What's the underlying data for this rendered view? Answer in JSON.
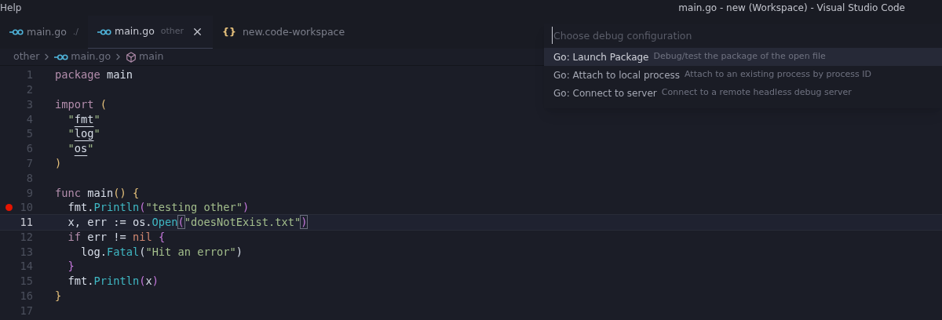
{
  "menu": {
    "label": "Help"
  },
  "window": {
    "title": "main.go - new (Workspace) - Visual Studio Code"
  },
  "tabs": [
    {
      "kind": "go",
      "label": "main.go",
      "description": "./",
      "selected": false
    },
    {
      "kind": "go",
      "label": "main.go",
      "description": "other",
      "selected": true
    },
    {
      "kind": "json",
      "icon": "{}",
      "label": "new.code-workspace",
      "selected": false
    }
  ],
  "breadcrumbs": [
    {
      "kind": "folder",
      "label": "other"
    },
    {
      "kind": "go",
      "label": "main.go"
    },
    {
      "kind": "symbol",
      "label": "main"
    }
  ],
  "editor": {
    "lines": [
      {
        "number": "1",
        "breakpoint": false,
        "current": false,
        "tokens": [
          {
            "kind": "keyword",
            "text": "package"
          },
          {
            "kind": "plain",
            "text": " main"
          }
        ]
      },
      {
        "number": "2",
        "breakpoint": false,
        "current": false
      },
      {
        "number": "3",
        "breakpoint": false,
        "current": false,
        "tokens": [
          {
            "kind": "keyword",
            "text": "import "
          },
          {
            "kind": "bracket1",
            "text": "("
          }
        ]
      },
      {
        "number": "4",
        "breakpoint": false,
        "current": false,
        "tokens": [
          {
            "kind": "string",
            "text": "  \""
          },
          {
            "kind": "import",
            "text": "fmt"
          },
          {
            "kind": "string",
            "text": "\""
          }
        ]
      },
      {
        "number": "5",
        "breakpoint": false,
        "current": false,
        "tokens": [
          {
            "kind": "string",
            "text": "  \""
          },
          {
            "kind": "import",
            "text": "log"
          },
          {
            "kind": "string",
            "text": "\""
          }
        ]
      },
      {
        "number": "6",
        "breakpoint": false,
        "current": false,
        "tokens": [
          {
            "kind": "string",
            "text": "  \""
          },
          {
            "kind": "import",
            "text": "os"
          },
          {
            "kind": "string",
            "text": "\""
          }
        ]
      },
      {
        "number": "7",
        "breakpoint": false,
        "current": false,
        "tokens": [
          {
            "kind": "bracket1",
            "text": ")"
          }
        ]
      },
      {
        "number": "8",
        "breakpoint": false,
        "current": false
      },
      {
        "number": "9",
        "breakpoint": false,
        "current": false,
        "tokens": [
          {
            "kind": "keyword",
            "text": "func"
          },
          {
            "kind": "plain",
            "text": " main"
          },
          {
            "kind": "bracket1",
            "text": "() {"
          }
        ]
      },
      {
        "number": "10",
        "breakpoint": true,
        "current": false,
        "tokens": [
          {
            "kind": "plain",
            "text": "  fmt."
          },
          {
            "kind": "function",
            "text": "Println"
          },
          {
            "kind": "bracket2",
            "text": "("
          },
          {
            "kind": "string",
            "text": "\"testing other\""
          },
          {
            "kind": "bracket2",
            "text": ")"
          }
        ]
      },
      {
        "number": "11",
        "breakpoint": false,
        "current": true,
        "tokens": [
          {
            "kind": "plain",
            "text": "  x, err := os."
          },
          {
            "kind": "function",
            "text": "Open"
          },
          {
            "kind": "bracket-match",
            "text": "("
          },
          {
            "kind": "string",
            "text": "\"doesNotExist.txt\""
          },
          {
            "kind": "bracket-match",
            "text": ")"
          }
        ]
      },
      {
        "number": "12",
        "breakpoint": false,
        "current": false,
        "tokens": [
          {
            "kind": "keyword",
            "text": "  if"
          },
          {
            "kind": "plain",
            "text": " err != "
          },
          {
            "kind": "constant",
            "text": "nil "
          },
          {
            "kind": "bracket2",
            "text": "{"
          }
        ]
      },
      {
        "number": "13",
        "breakpoint": false,
        "current": false,
        "tokens": [
          {
            "kind": "plain",
            "text": "    log."
          },
          {
            "kind": "function",
            "text": "Fatal"
          },
          {
            "kind": "plain",
            "text": "("
          },
          {
            "kind": "string",
            "text": "\"Hit an error\""
          },
          {
            "kind": "plain",
            "text": ")"
          }
        ]
      },
      {
        "number": "14",
        "breakpoint": false,
        "current": false,
        "tokens": [
          {
            "kind": "bracket2",
            "text": "  }"
          }
        ]
      },
      {
        "number": "15",
        "breakpoint": false,
        "current": false,
        "tokens": [
          {
            "kind": "plain",
            "text": "  fmt."
          },
          {
            "kind": "function",
            "text": "Println"
          },
          {
            "kind": "bracket2",
            "text": "("
          },
          {
            "kind": "plain",
            "text": "x"
          },
          {
            "kind": "bracket2",
            "text": ")"
          }
        ]
      },
      {
        "number": "16",
        "breakpoint": false,
        "current": false,
        "tokens": [
          {
            "kind": "bracket1",
            "text": "}"
          }
        ]
      },
      {
        "number": "17",
        "breakpoint": false,
        "current": false
      }
    ]
  },
  "quick_pick": {
    "placeholder": "Choose debug configuration",
    "items": [
      {
        "label": "Go: Launch Package",
        "description": "Debug/test the package of the open file",
        "selected": true
      },
      {
        "label": "Go: Attach to local process",
        "description": "Attach to an existing process by process ID",
        "selected": false
      },
      {
        "label": "Go: Connect to server",
        "description": "Connect to a remote headless debug server",
        "selected": false
      }
    ]
  }
}
